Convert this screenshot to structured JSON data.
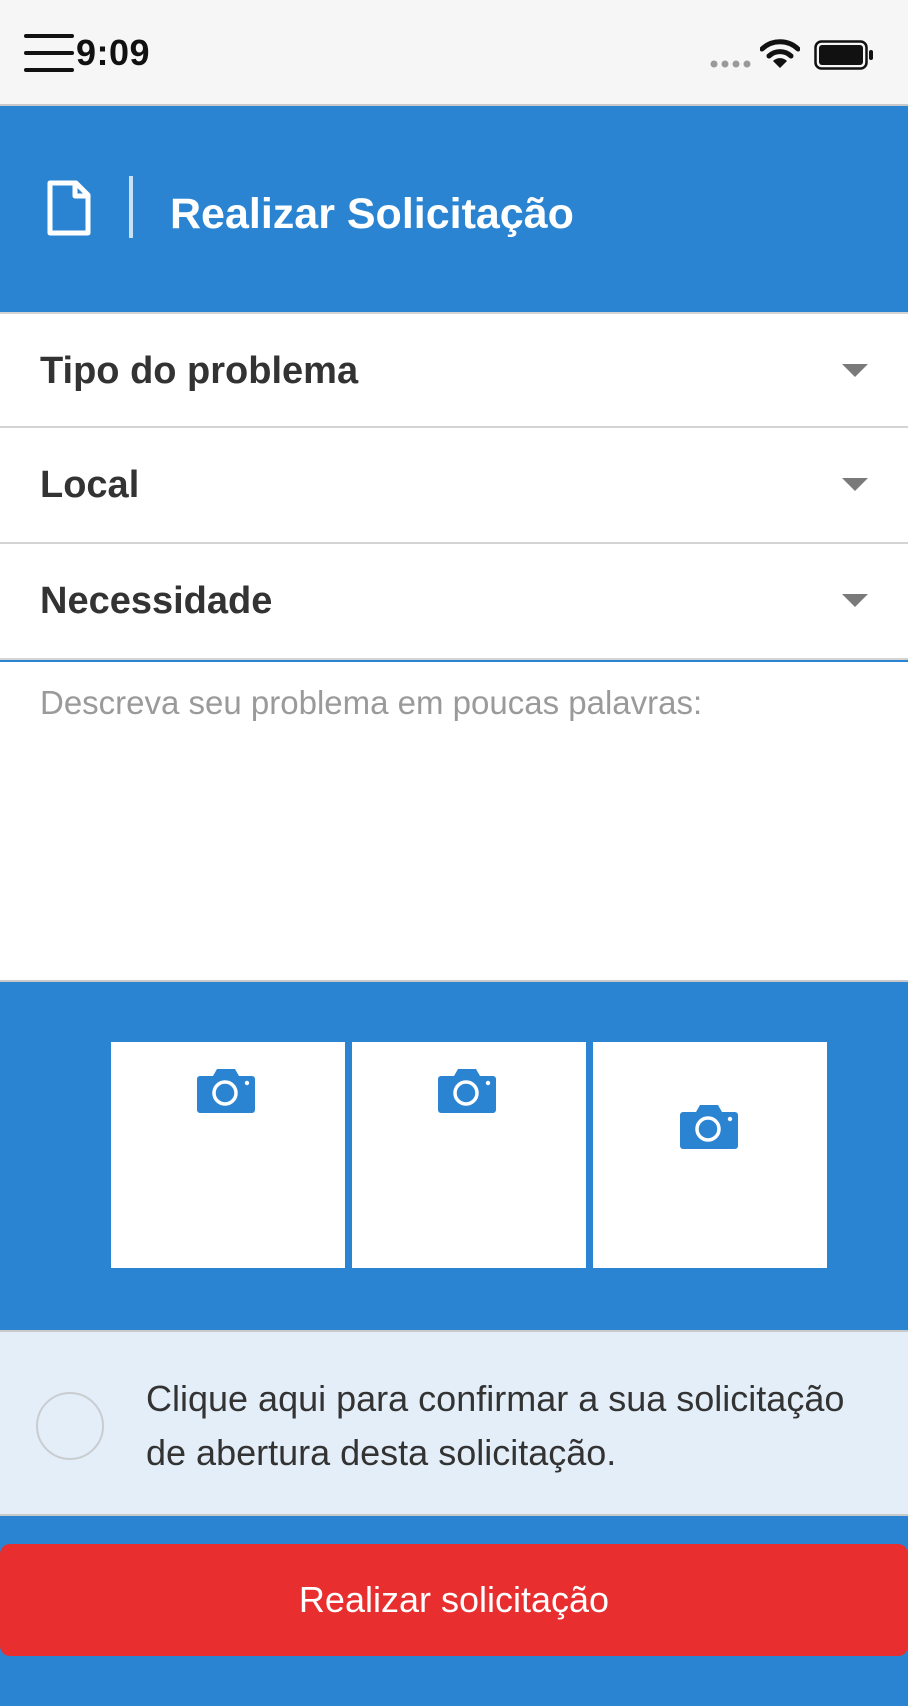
{
  "status_bar": {
    "time": "9:09",
    "icons": [
      "menu-icon",
      "signal-icon",
      "wifi-icon",
      "battery-icon"
    ]
  },
  "header": {
    "icon": "document-icon",
    "title": "Realizar Solicitação"
  },
  "form": {
    "selects": [
      {
        "label": "Tipo do problema"
      },
      {
        "label": "Local"
      },
      {
        "label": "Necessidade"
      }
    ],
    "description": {
      "placeholder": "Descreva seu problema em poucas palavras:",
      "value": ""
    }
  },
  "photos": {
    "slots": [
      {
        "icon": "camera-icon"
      },
      {
        "icon": "camera-icon"
      },
      {
        "icon": "camera-icon"
      }
    ]
  },
  "confirm": {
    "text": "Clique aqui para confirmar a sua solicitação de abertura desta solicitação.",
    "checked": false
  },
  "submit": {
    "label": "Realizar solicitação"
  },
  "colors": {
    "primary": "#2b84d2",
    "danger": "#e82e2e",
    "confirm_bg": "#e3eef8",
    "text": "#333333",
    "placeholder": "#9a9a9a"
  }
}
